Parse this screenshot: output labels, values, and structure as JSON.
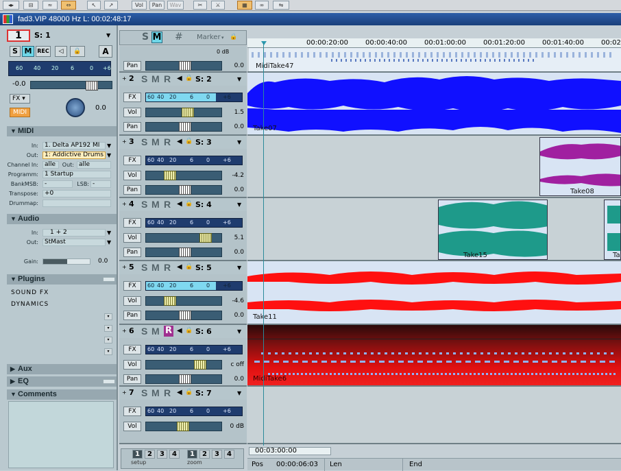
{
  "toolbar": {
    "vol": "Vol",
    "pan": "Pan",
    "wav": "Wav"
  },
  "window": {
    "title": "fad3.VIP   48000 Hz L: 00:02:48:17"
  },
  "inspector": {
    "track_number": "1",
    "track_select": "S: 1",
    "buttons": [
      "S",
      "M",
      "REC"
    ],
    "auto_label": "A",
    "meter_scale": [
      "60",
      "40",
      "20",
      "6",
      "0",
      "+6"
    ],
    "volume_value": "-0.0",
    "fx_label": "FX",
    "midi_btn": "MIDI",
    "knob_value": "0.0",
    "midi": {
      "title": "MIDI",
      "in_label": "In:",
      "in_value": "1. Delta AP192 MI",
      "out_label": "Out:",
      "out_value": "1: Addictive Drums",
      "channel_in_label": "Channel In:",
      "channel_in_value": "alle",
      "channel_out_label": "Out:",
      "channel_out_value": "alle",
      "program_label": "Programm:",
      "program_value": "1 Startup",
      "bank_label": "BankMSB:",
      "bank_value": "-",
      "lsb_label": "LSB:",
      "lsb_value": "-",
      "transpose_label": "Transpose:",
      "transpose_value": "+0",
      "drummap_label": "Drummap:"
    },
    "audio": {
      "title": "Audio",
      "in_label": "In:",
      "in_value": "1 + 2",
      "out_label": "Out:",
      "out_value": "StMast",
      "gain_label": "Gain:",
      "gain_value": "0.0"
    },
    "plugins": {
      "title": "Plugins",
      "items": [
        "SOUND FX",
        "DYNAMICS"
      ]
    },
    "aux": {
      "title": "Aux"
    },
    "eq": {
      "title": "EQ"
    },
    "comments": {
      "title": "Comments"
    }
  },
  "track_header": {
    "s": "S",
    "m": "M",
    "grid": "#",
    "marker": "Marker"
  },
  "track0": {
    "level": "0 dB",
    "pan_label": "Pan",
    "pan_value": "0.0"
  },
  "tracks": [
    {
      "num": "2",
      "sel": "S: 2",
      "vol": "1.5",
      "pan": "0.0"
    },
    {
      "num": "3",
      "sel": "S: 3",
      "vol": "-4.2",
      "pan": "0.0"
    },
    {
      "num": "4",
      "sel": "S: 4",
      "vol": "5.1",
      "pan": "0.0"
    },
    {
      "num": "5",
      "sel": "S: 5",
      "vol": "-4.6",
      "pan": "0.0"
    },
    {
      "num": "6",
      "sel": "S: 6",
      "vol": "c off",
      "pan": "0.0"
    },
    {
      "num": "7",
      "sel": "S: 7",
      "vol": "0 dB"
    }
  ],
  "labels": {
    "fx": "FX",
    "vol": "Vol",
    "pan": "Pan"
  },
  "meter_scale": [
    "60",
    "40",
    "20",
    "6",
    "0",
    "+6"
  ],
  "ruler": [
    "00:00:20:00",
    "00:00:40:00",
    "00:01:00:00",
    "00:01:20:00",
    "00:01:40:00",
    "00:02"
  ],
  "clips": {
    "midi1": "MidiTake47",
    "audio2": "Take07",
    "audio3": "Take08",
    "audio4a": "Take15",
    "audio4b": "Ta",
    "audio5": "Take11",
    "midi6": "MidiTake6"
  },
  "colors": {
    "take07": "#1010ff",
    "take08": "#a020a0",
    "take15": "#1e9a8a",
    "take11": "#ff1010",
    "midi6": "#e01010"
  },
  "bottom": {
    "setup_tabs": [
      "1",
      "2",
      "3",
      "4"
    ],
    "setup_label": "setup",
    "zoom_tabs": [
      "1",
      "2",
      "3",
      "4"
    ],
    "zoom_label": "zoom",
    "timebox": "00:03:00:00",
    "pos_label": "Pos",
    "pos_value": "00:00:06:03",
    "len_label": "Len",
    "end_label": "End"
  }
}
